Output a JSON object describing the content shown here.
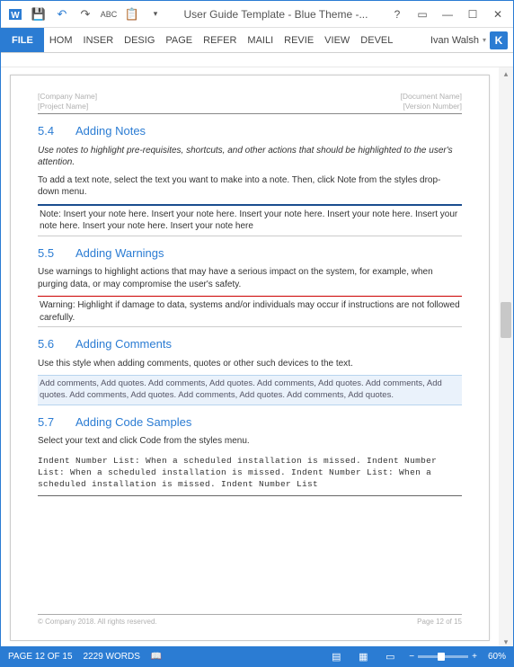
{
  "titlebar": {
    "title": "User Guide Template - Blue Theme -..."
  },
  "ribbon": {
    "file": "FILE",
    "tabs": [
      "HOM",
      "INSER",
      "DESIG",
      "PAGE",
      "REFER",
      "MAILI",
      "REVIE",
      "VIEW",
      "DEVEL"
    ],
    "user": "Ivan Walsh",
    "badge": "K"
  },
  "doc": {
    "hdr": {
      "tl": "[Company Name]",
      "bl": "[Project Name]",
      "tr": "[Document Name]",
      "br": "[Version Number]"
    },
    "s54": {
      "num": "5.4",
      "title": "Adding Notes",
      "p1": "Use notes to highlight pre-requisites, shortcuts, and other actions that should be highlighted to the user's attention.",
      "p2": "To add a text note, select the text you want to make into a note. Then, click Note from the styles drop-down menu.",
      "note": "Note: Insert your note here. Insert your note here. Insert your note here. Insert your note here. Insert your note here. Insert your note here. Insert your note here"
    },
    "s55": {
      "num": "5.5",
      "title": "Adding Warnings",
      "p1": "Use warnings to highlight actions that may have a serious impact on the system, for example, when purging data, or may compromise the user's safety.",
      "warn": "Warning: Highlight if damage to data, systems and/or individuals may occur if instructions are not followed carefully."
    },
    "s56": {
      "num": "5.6",
      "title": "Adding Comments",
      "p1": "Use this style when adding comments, quotes or other such devices to the text.",
      "cmt": "Add comments, Add quotes. Add comments, Add quotes. Add comments, Add quotes. Add comments, Add quotes. Add comments, Add quotes. Add comments, Add quotes. Add comments, Add quotes."
    },
    "s57": {
      "num": "5.7",
      "title": "Adding Code Samples",
      "p1": "Select your text and click Code from the styles menu.",
      "code": "Indent Number List: When a scheduled installation is missed. Indent Number List: When a scheduled installation is missed. Indent Number List: When a scheduled installation is missed. Indent Number List"
    },
    "ftr": {
      "l": "© Company 2018. All rights reserved.",
      "r": "Page 12 of 15"
    }
  },
  "status": {
    "page": "PAGE 12 OF 15",
    "words": "2229 WORDS",
    "zoom": "60%"
  }
}
